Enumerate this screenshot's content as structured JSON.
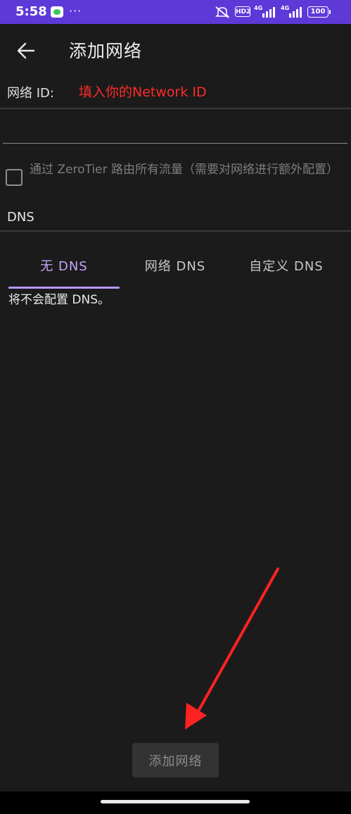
{
  "status_bar": {
    "time": "5:58",
    "notification_icons": [
      "wechat-icon"
    ],
    "more": "···",
    "hd_badge": "HD2",
    "network_1": "4G",
    "network_2": "4G",
    "battery": "100"
  },
  "header": {
    "back_icon": "arrow-left-icon",
    "title": "添加网络"
  },
  "network_id": {
    "label": "网络 ID:",
    "annotation": "填入你的Network ID",
    "value": "",
    "placeholder": ""
  },
  "route_all_traffic": {
    "checked": false,
    "label": "通过 ZeroTier 路由所有流量（需要对网络进行额外配置）"
  },
  "dns": {
    "label": "DNS",
    "tabs": [
      {
        "label": "无 DNS",
        "selected": true
      },
      {
        "label": "网络 DNS",
        "selected": false
      },
      {
        "label": "自定义 DNS",
        "selected": false
      }
    ],
    "description": "将不会配置 DNS。"
  },
  "footer": {
    "add_button": "添加网络"
  },
  "colors": {
    "status_bar": "#5d39d8",
    "background": "#1b1b1b",
    "accent": "#c6a4ff",
    "annotation": "#ff2a2a"
  }
}
